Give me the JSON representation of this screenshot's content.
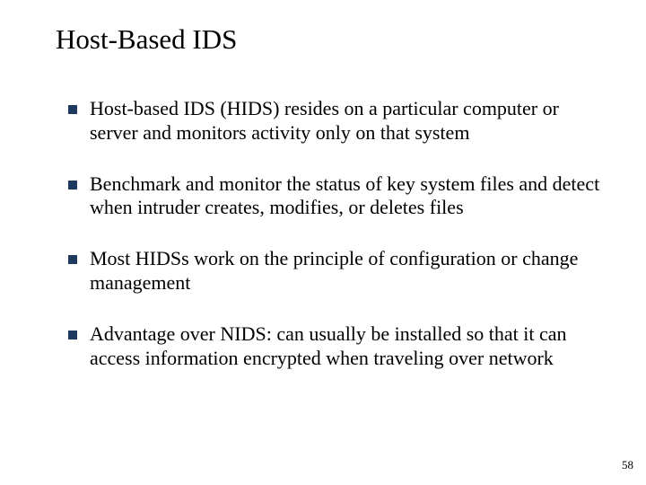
{
  "title": "Host-Based IDS",
  "bullets": [
    "Host-based IDS (HIDS) resides on a particular computer or server and monitors activity only on that system",
    "Benchmark and monitor the status of key system files and detect when intruder creates, modifies, or deletes files",
    "Most HIDSs work on the principle of configuration or change management",
    "Advantage over NIDS: can usually be installed so that it can access information encrypted when traveling over network"
  ],
  "pageNumber": "58",
  "colors": {
    "bulletMarker": "#1f3a5f"
  }
}
